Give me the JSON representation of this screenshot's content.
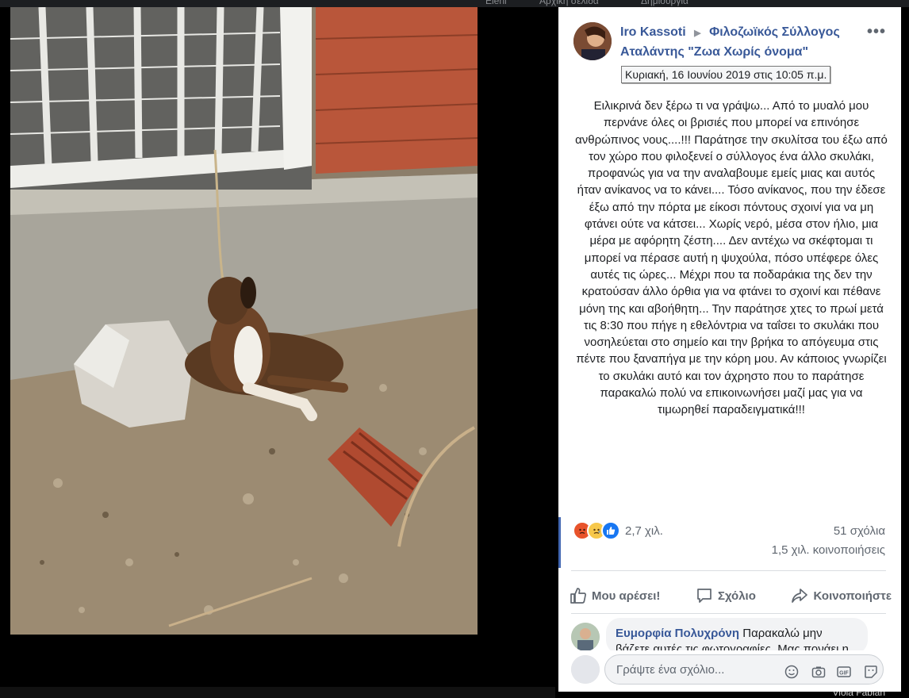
{
  "topbar": {
    "items": [
      "Eleni",
      "Αρχική σελίδα",
      "Δημιουργία"
    ]
  },
  "post": {
    "author": "Iro Kassoti",
    "group": "Φιλοζωϊκός Σύλλογος Αταλάντης \"Ζωα Χωρίς όνομα\"",
    "timestamp_tooltip": "Κυριακή, 16 Ιουνίου 2019 στις 10:05 π.μ.",
    "more_label": "•••",
    "body": "Ειλικρινά δεν ξέρω τι να γράψω... Από το μυαλό μου περνάνε όλες οι βρισιές που μπορεί να επινόησε ανθρώπινος νους....!!! Παράτησε την σκυλίτσα του έξω από τον χώρο που φιλοξενεί ο σύλλογος ένα άλλο σκυλάκι, προφανώς για να την αναλαβουμε εμείς μιας και αυτός ήταν ανίκανος να το κάνει.... Τόσο ανίκανος, που την έδεσε έξω από την πόρτα με είκοσι πόντους σχοινί για να μη φτάνει ούτε να κάτσει... Χωρίς νερό, μέσα στον ήλιο, μια μέρα με αφόρητη ζέστη.... Δεν αντέχω να σκέφτομαι τι μπορεί να πέρασε αυτή η ψυχούλα, πόσο υπέφερε όλες αυτές τις ώρες... Μέχρι που τα ποδαράκια της δεν την κρατούσαν άλλο όρθια για να φτάνει το σχοινί και πέθανε μόνη της και αβοήθητη... Την παράτησε χτες το πρωί μετά τις 8:30 που πήγε η εθελόντρια να ταΐσει το σκυλάκι που νοσηλεύεται στο σημείο και την βρήκα το απόγευμα στις πέντε που ξαναπήγα με την κόρη μου. Αν κάποιος γνωρίζει το σκυλάκι αυτό και τον άχρηστο που το παράτησε παρακαλώ πολύ να επικοινωνήσει μαζί μας για να τιμωρηθεί παραδειγματικά!!!",
    "reactions_count": "2,7 χιλ.",
    "comments_count": "51 σχόλια",
    "shares_count": "1,5 χιλ. κοινοποιήσεις"
  },
  "actions": {
    "like": "Μου αρέσει!",
    "comment": "Σχόλιο",
    "share": "Κοινοποιήστε"
  },
  "comment": {
    "name": "Ευμορφία Πολυχρόνη",
    "text": "Παρακαλώ μην βάζετε αυτές τις φωτογραφίες. Μας πονάει η"
  },
  "composer": {
    "placeholder": "Γράψτε ένα σχόλιο..."
  },
  "bottom_right": "Viola Fabian",
  "colors": {
    "link": "#385898",
    "like": "#1877f2",
    "angry": "#e8532b",
    "sad": "#f7c84b"
  }
}
